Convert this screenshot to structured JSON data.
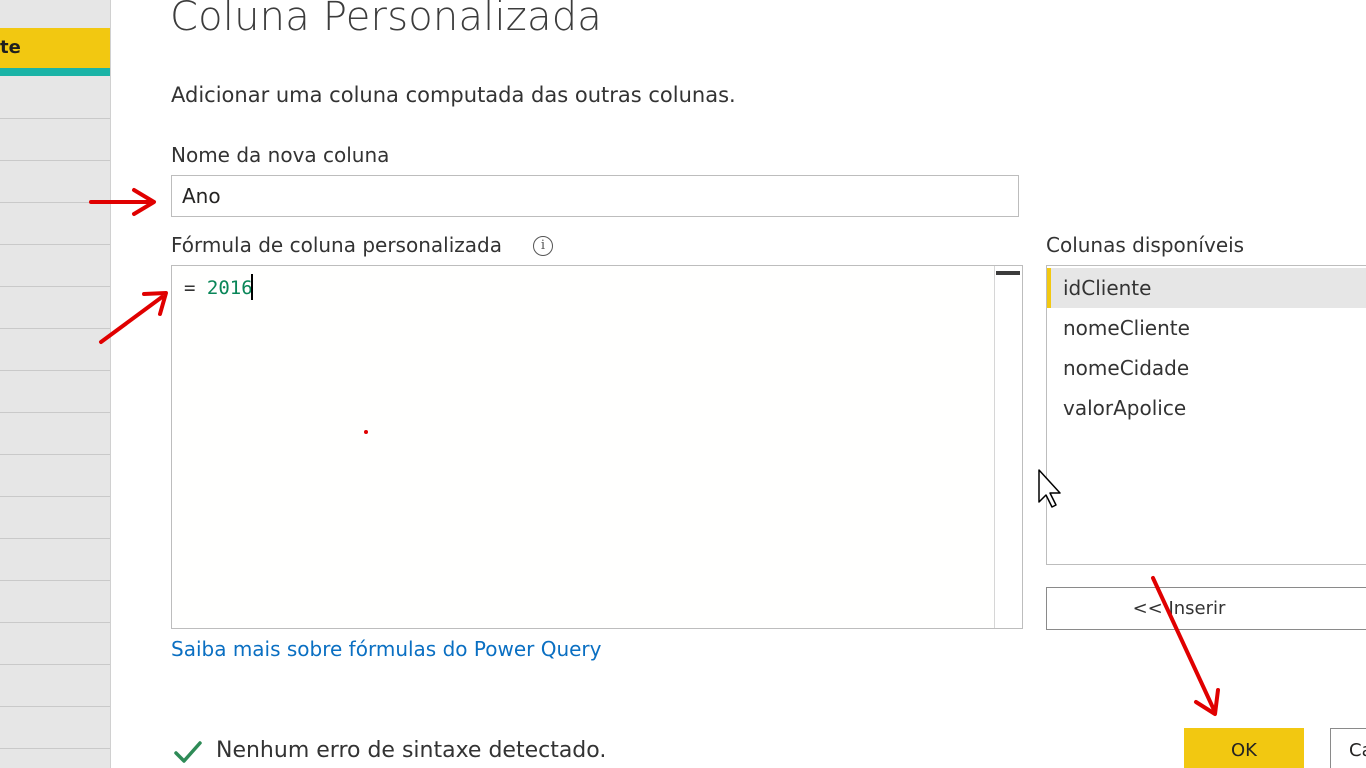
{
  "background": {
    "tab_label": "te",
    "accent_color": "#f2c811",
    "underline_color": "#1ab3a6"
  },
  "dialog": {
    "title": "Coluna Personalizada",
    "subtitle": "Adicionar uma coluna computada das outras colunas."
  },
  "name_field": {
    "label": "Nome da nova coluna",
    "value": "Ano"
  },
  "formula": {
    "label": "Fórmula de coluna personalizada",
    "info_icon": "info-icon",
    "prefix": "= ",
    "value": "2016",
    "number_color": "#098658"
  },
  "available_columns": {
    "label": "Colunas disponíveis",
    "items": [
      "idCliente",
      "nomeCliente",
      "nomeCidade",
      "valorApolice"
    ],
    "selected": "idCliente",
    "insert_label": "<< Inserir"
  },
  "help_link": "Saiba mais sobre fórmulas do Power Query",
  "status": {
    "icon": "check-icon",
    "text": "Nenhum erro de sintaxe detectado.",
    "color": "#2e8b57"
  },
  "buttons": {
    "ok_label": "OK",
    "cancel_label": "Ca"
  },
  "annotations": {
    "arrow_color": "#e00000"
  }
}
